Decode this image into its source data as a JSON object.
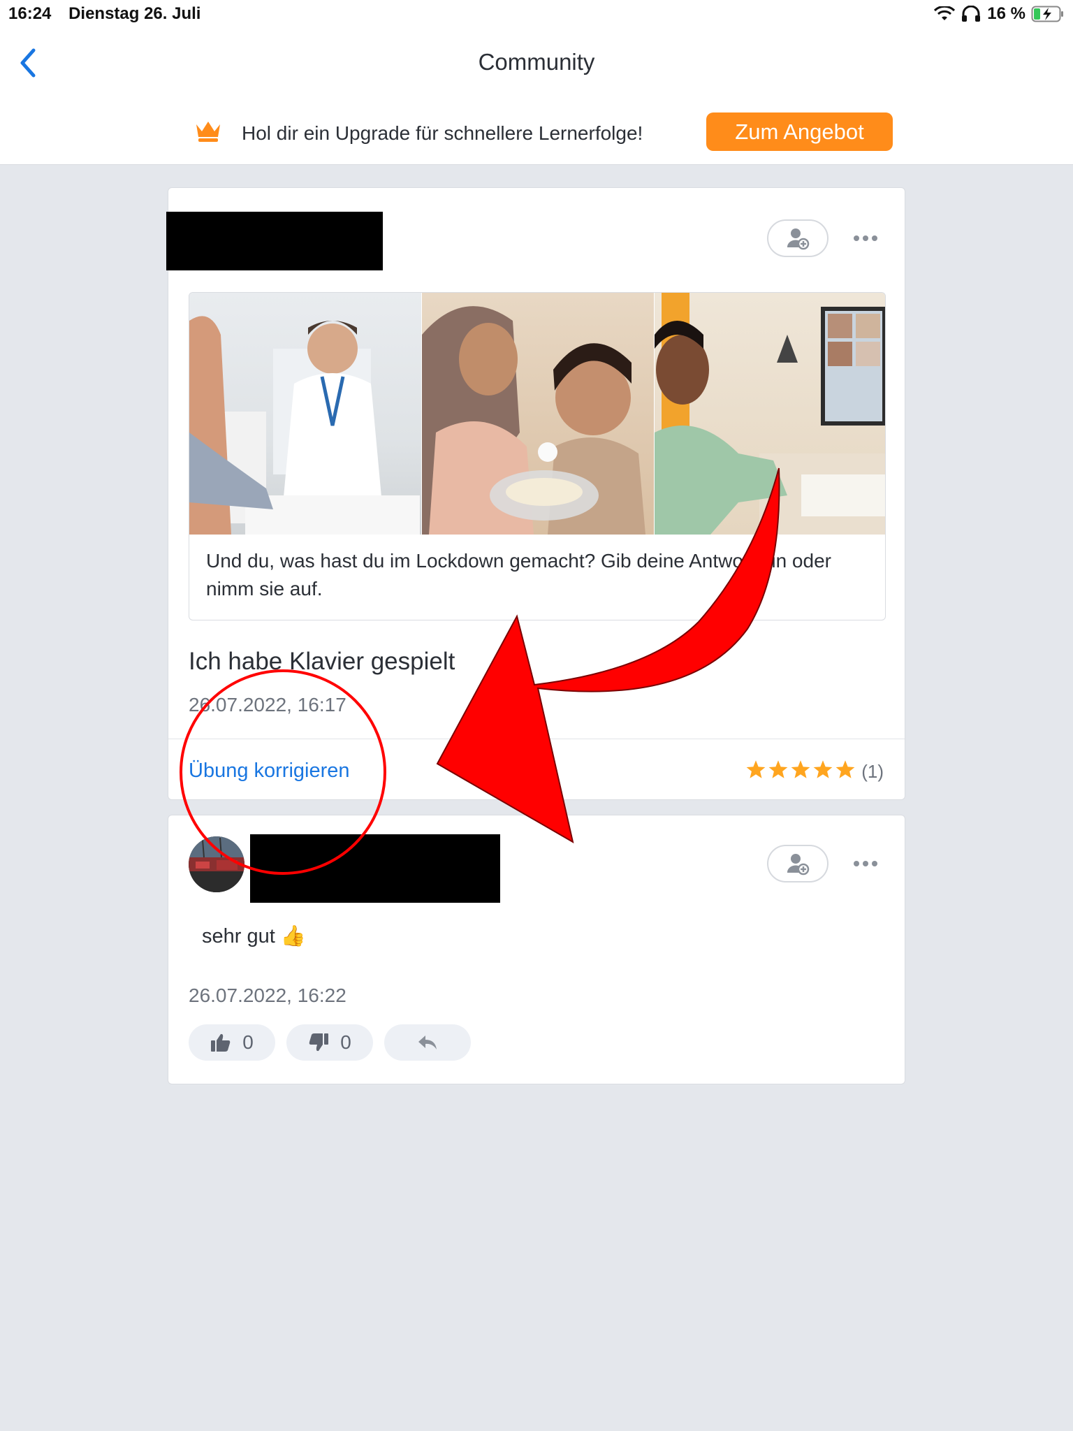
{
  "status_bar": {
    "time": "16:24",
    "date": "Dienstag 26. Juli",
    "battery": "16 %"
  },
  "nav": {
    "title": "Community",
    "back_icon": "chevron-left-icon"
  },
  "promo": {
    "text": "Hol dir ein Upgrade für schnellere Lernerfolge!",
    "button": "Zum Angebot",
    "icon": "crown-icon"
  },
  "post": {
    "exercise_text": "Und du, was hast du im Lockdown gemacht? Gib deine Antwort ein oder nimm sie auf.",
    "answer": "Ich habe Klavier gespielt",
    "timestamp": "26.07.2022, 16:17",
    "correct_link": "Übung korrigieren",
    "rating_stars": 5,
    "rating_count": "(1)"
  },
  "reply": {
    "text": "sehr gut 👍",
    "timestamp": "26.07.2022, 16:22",
    "likes": "0",
    "dislikes": "0"
  },
  "colors": {
    "accent": "#ff8c1a",
    "link": "#1976e1",
    "background": "#e4e7ec",
    "annotation": "#ff0000"
  }
}
